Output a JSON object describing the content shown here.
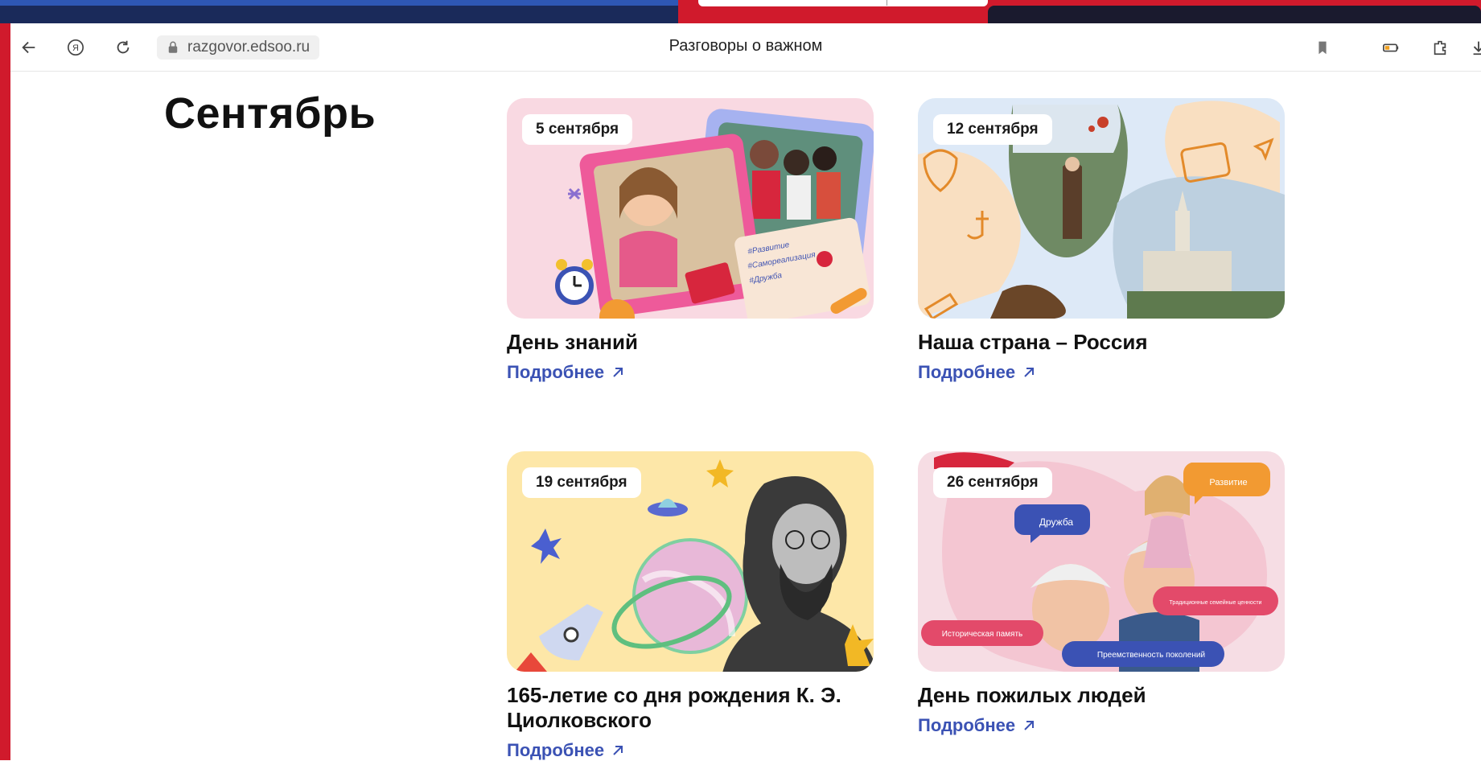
{
  "browser": {
    "url": "razgovor.edsoo.ru",
    "page_title": "Разговоры о важном",
    "icons": [
      "back-arrow-icon",
      "yandex-icon",
      "reload-icon",
      "lock-icon",
      "bookmark-icon",
      "battery-icon",
      "extensions-icon",
      "download-icon"
    ]
  },
  "month": "Сентябрь",
  "cards": [
    {
      "date": "5 сентября",
      "title": "День знаний",
      "link": "Подробнее"
    },
    {
      "date": "12 сентября",
      "title": "Наша страна – Россия",
      "link": "Подробнее"
    },
    {
      "date": "19 сентября",
      "title": "165-летие со дня рождения К. Э. Циолковского",
      "link": "Подробнее"
    },
    {
      "date": "26 сентября",
      "title": "День пожилых людей",
      "link": "Подробнее"
    }
  ],
  "card_tags": {
    "knowledge": [
      "#Развитие",
      "#Самореализация",
      "#Дружба"
    ],
    "elderly": [
      "Дружба",
      "Развитие",
      "Традиционные семейные ценности",
      "Историческая память",
      "Преемственность поколений"
    ]
  },
  "colors": {
    "frame_red": "#d01a2c",
    "link_blue": "#3b52b4",
    "card1_bg": "#f9d9e2",
    "card2_bg": "#dde9f7",
    "card3_bg": "#fde7a8",
    "card4_bg": "#f6dde4"
  }
}
